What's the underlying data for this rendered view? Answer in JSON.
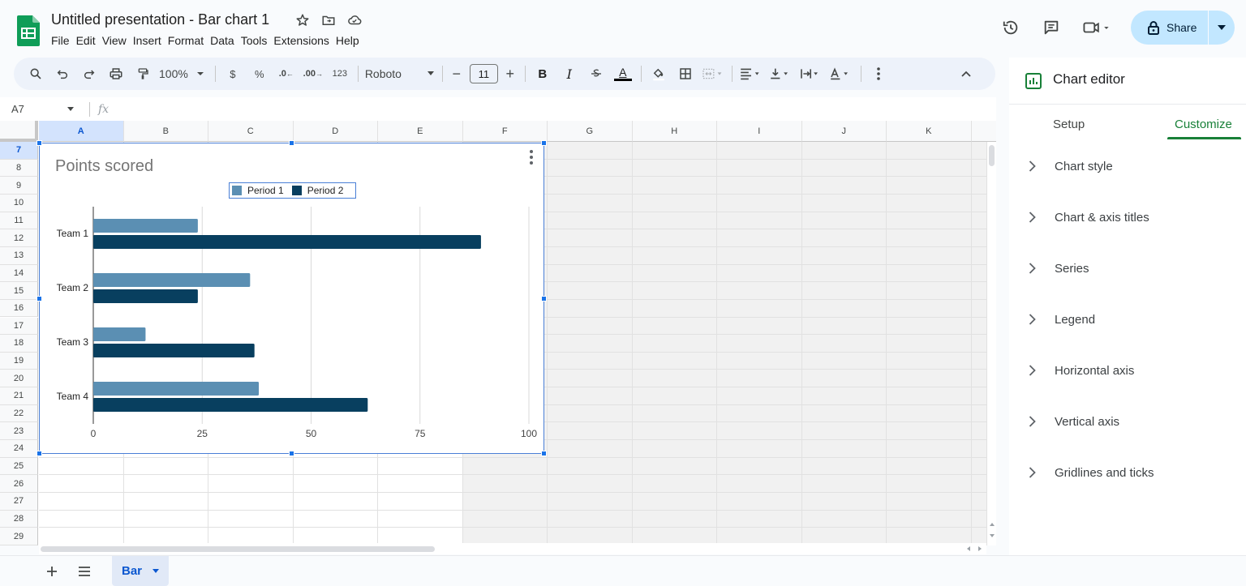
{
  "document": {
    "title": "Untitled presentation - Bar chart 1",
    "menu": [
      "File",
      "Edit",
      "View",
      "Insert",
      "Format",
      "Data",
      "Tools",
      "Extensions",
      "Help"
    ]
  },
  "header": {
    "share_label": "Share",
    "icons": [
      "history-icon",
      "comment-icon",
      "meet-icon",
      "lock-icon"
    ]
  },
  "toolbar": {
    "zoom": "100%",
    "currency": "$",
    "percent": "%",
    "decrease_decimal": ".0",
    "increase_decimal": ".00",
    "number_format": "123",
    "font": "Roboto",
    "font_size": "11",
    "bold": "B",
    "italic": "I",
    "text_color_label": "A",
    "minus": "−",
    "plus": "+"
  },
  "formula_bar": {
    "cell_ref": "A7",
    "fx": "fx",
    "value": ""
  },
  "grid": {
    "columns": [
      "A",
      "B",
      "C",
      "D",
      "E",
      "F",
      "G",
      "H",
      "I",
      "J",
      "K"
    ],
    "selected_column": "A",
    "rows": [
      "7",
      "8",
      "9",
      "10",
      "11",
      "12",
      "13",
      "14",
      "15",
      "16",
      "17",
      "18",
      "19",
      "20",
      "21",
      "22",
      "23",
      "24",
      "25",
      "26",
      "27",
      "28",
      "29"
    ],
    "selected_row": "7"
  },
  "chart_data": {
    "type": "bar",
    "orientation": "horizontal",
    "title": "Points scored",
    "categories": [
      "Team 1",
      "Team 2",
      "Team 3",
      "Team 4"
    ],
    "series": [
      {
        "name": "Period 1",
        "values": [
          24,
          36,
          12,
          38
        ],
        "color": "#5b8fb3"
      },
      {
        "name": "Period 2",
        "values": [
          89,
          24,
          37,
          63
        ],
        "color": "#083f5f"
      }
    ],
    "xlim": [
      0,
      100
    ],
    "xticks": [
      "0",
      "25",
      "50",
      "75",
      "100"
    ],
    "grid": true,
    "legend_position": "top"
  },
  "panel": {
    "title": "Chart editor",
    "tabs": [
      "Setup",
      "Customize"
    ],
    "active_tab": "Customize",
    "sections": [
      "Chart style",
      "Chart & axis titles",
      "Series",
      "Legend",
      "Horizontal axis",
      "Vertical axis",
      "Gridlines and ticks"
    ]
  },
  "sheets": {
    "active": "Bar"
  }
}
